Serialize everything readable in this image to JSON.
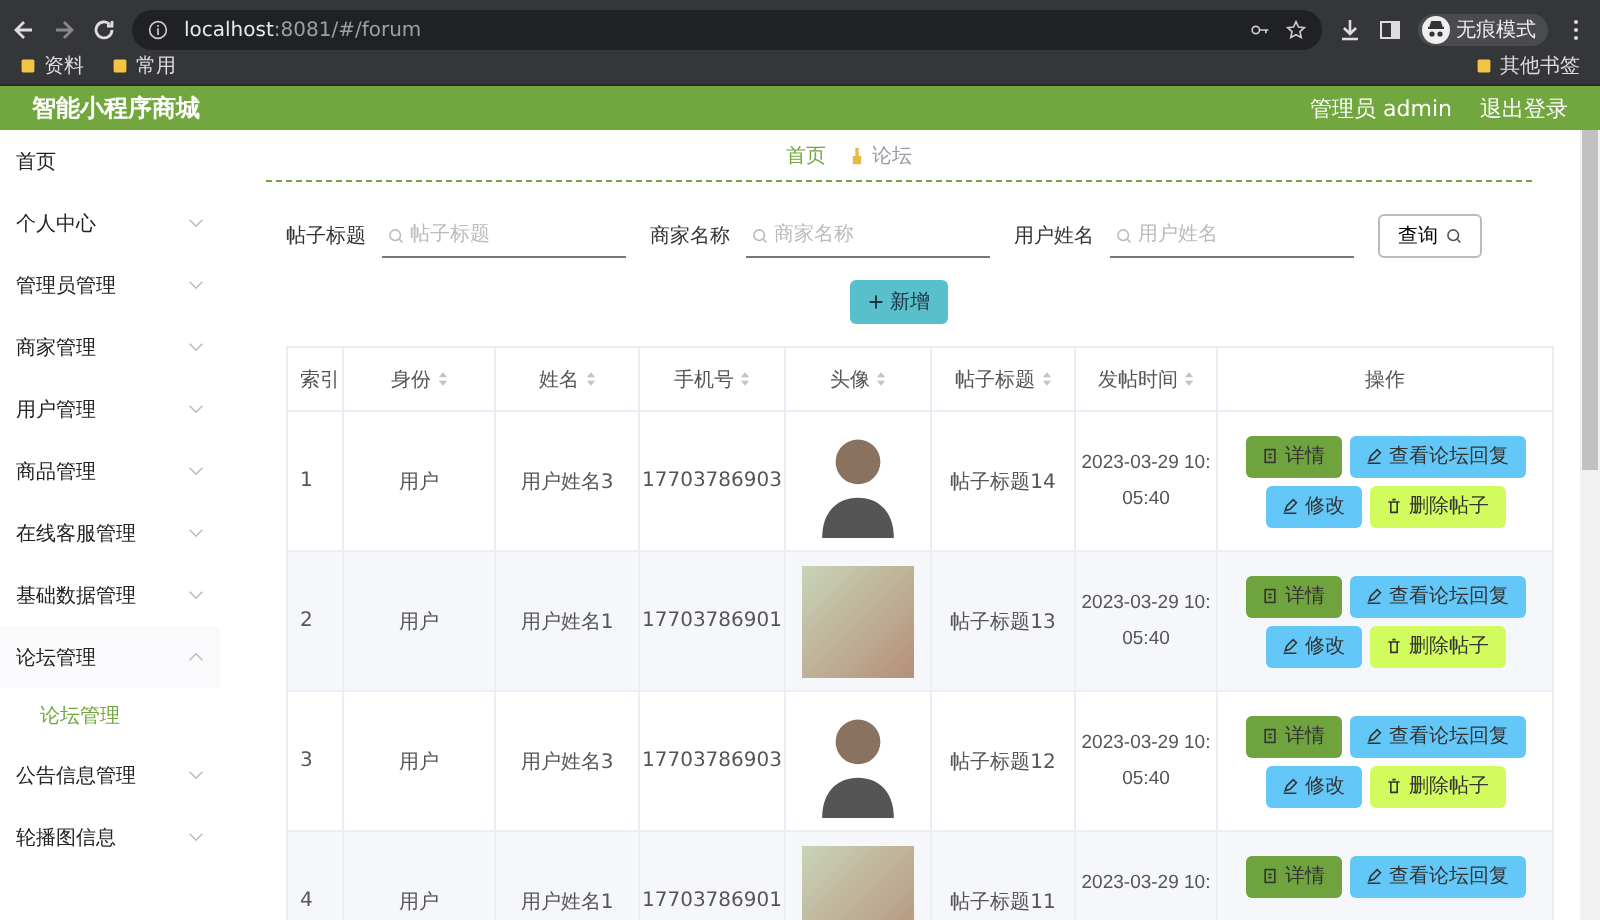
{
  "browser": {
    "url_host": "localhost",
    "url_rest": ":8081/#/forum",
    "profile": "无痕模式",
    "bookmarks": [
      "资料",
      "常用"
    ],
    "other_bookmarks": "其他书签"
  },
  "header": {
    "title": "智能小程序商城",
    "user": "管理员 admin",
    "logout": "退出登录"
  },
  "sidebar": {
    "items": [
      {
        "label": "首页",
        "kind": "link"
      },
      {
        "label": "个人中心",
        "kind": "submenu",
        "expanded": false
      },
      {
        "label": "管理员管理",
        "kind": "submenu",
        "expanded": false
      },
      {
        "label": "商家管理",
        "kind": "submenu",
        "expanded": false
      },
      {
        "label": "用户管理",
        "kind": "submenu",
        "expanded": false
      },
      {
        "label": "商品管理",
        "kind": "submenu",
        "expanded": false
      },
      {
        "label": "在线客服管理",
        "kind": "submenu",
        "expanded": false
      },
      {
        "label": "基础数据管理",
        "kind": "submenu",
        "expanded": false
      },
      {
        "label": "论坛管理",
        "kind": "submenu",
        "expanded": true,
        "children": [
          {
            "label": "论坛管理",
            "selected": true
          }
        ]
      },
      {
        "label": "公告信息管理",
        "kind": "submenu",
        "expanded": false
      },
      {
        "label": "轮播图信息",
        "kind": "submenu",
        "expanded": false
      }
    ]
  },
  "breadcrumb": [
    "首页",
    "论坛"
  ],
  "search": {
    "fields": [
      {
        "label": "帖子标题",
        "placeholder": "帖子标题"
      },
      {
        "label": "商家名称",
        "placeholder": "商家名称"
      },
      {
        "label": "用户姓名",
        "placeholder": "用户姓名"
      }
    ],
    "button": "查询"
  },
  "add_button": "新增",
  "table": {
    "columns": [
      {
        "label": "索引",
        "sortable": false
      },
      {
        "label": "身份",
        "sortable": true
      },
      {
        "label": "姓名",
        "sortable": true
      },
      {
        "label": "手机号",
        "sortable": true
      },
      {
        "label": "头像",
        "sortable": true
      },
      {
        "label": "帖子标题",
        "sortable": true
      },
      {
        "label": "发帖时间",
        "sortable": true
      },
      {
        "label": "操作",
        "sortable": false
      }
    ],
    "rows": [
      {
        "index": "1",
        "role": "用户",
        "name": "用户姓名3",
        "phone": "17703786903",
        "avatar": {
          "kind": "drawing"
        },
        "title": "帖子标题14",
        "time": "2023-03-29 10:05:40",
        "actions": [
          {
            "kind": "detail",
            "label": "详情"
          },
          {
            "kind": "replies",
            "label": "查看论坛回复"
          },
          {
            "kind": "edit",
            "label": "修改"
          },
          {
            "kind": "delete",
            "label": "删除帖子"
          }
        ]
      },
      {
        "index": "2",
        "role": "用户",
        "name": "用户姓名1",
        "phone": "17703786901",
        "avatar": {
          "kind": "photo"
        },
        "title": "帖子标题13",
        "time": "2023-03-29 10:05:40",
        "actions": [
          {
            "kind": "detail",
            "label": "详情"
          },
          {
            "kind": "replies",
            "label": "查看论坛回复"
          },
          {
            "kind": "edit",
            "label": "修改"
          },
          {
            "kind": "delete",
            "label": "删除帖子"
          }
        ]
      },
      {
        "index": "3",
        "role": "用户",
        "name": "用户姓名3",
        "phone": "17703786903",
        "avatar": {
          "kind": "drawing"
        },
        "title": "帖子标题12",
        "time": "2023-03-29 10:05:40",
        "actions": [
          {
            "kind": "detail",
            "label": "详情"
          },
          {
            "kind": "replies",
            "label": "查看论坛回复"
          },
          {
            "kind": "edit",
            "label": "修改"
          },
          {
            "kind": "delete",
            "label": "删除帖子"
          }
        ]
      },
      {
        "index": "4",
        "role": "用户",
        "name": "用户姓名1",
        "phone": "17703786901",
        "avatar": {
          "kind": "photo"
        },
        "title": "帖子标题11",
        "time": "2023-03-29 10:",
        "actions": [
          {
            "kind": "detail",
            "label": "详情"
          },
          {
            "kind": "replies",
            "label": "查看论坛回复"
          }
        ]
      }
    ]
  }
}
